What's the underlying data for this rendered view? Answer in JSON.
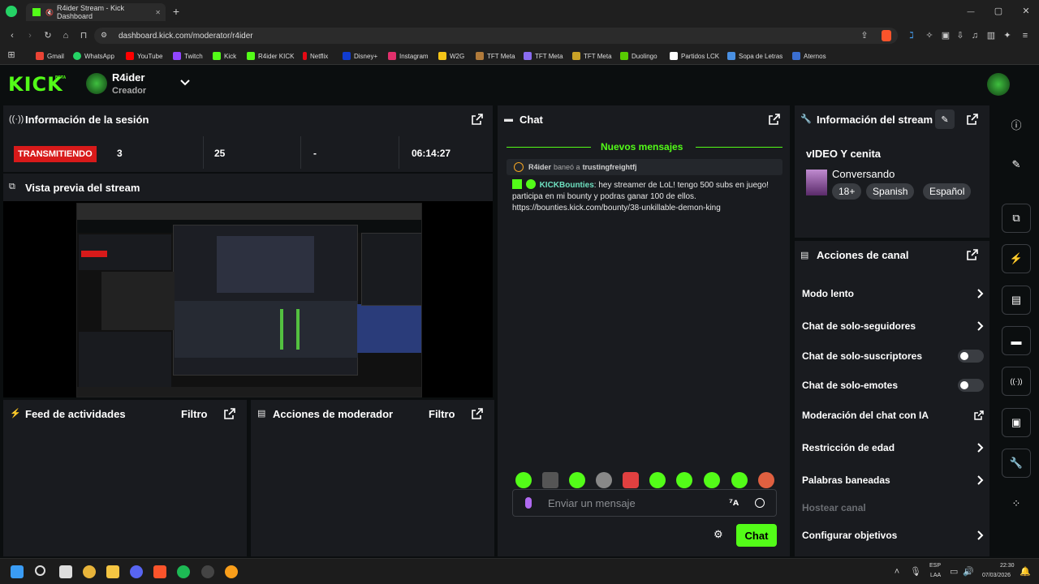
{
  "browser": {
    "tabs": [
      {
        "label": "R4ider Stream - Kick Dashboard",
        "close": "✕"
      }
    ],
    "new_tab": "+",
    "url": "dashboard.kick.com/moderator/r4ider",
    "window_controls": {
      "minimize": "—",
      "maximize": "▢",
      "close": "✕"
    },
    "bookmarks": [
      {
        "label": "Gmail",
        "color": "#ea4335"
      },
      {
        "label": "WhatsApp",
        "color": "#25d366"
      },
      {
        "label": "YouTube",
        "color": "#ff0000"
      },
      {
        "label": "Twitch",
        "color": "#9146ff"
      },
      {
        "label": "Kick",
        "color": "#53fc18"
      },
      {
        "label": "R4ider KICK",
        "color": "#53fc18"
      },
      {
        "label": "Netflix",
        "color": "#e50914"
      },
      {
        "label": "Disney+",
        "color": "#113ccf"
      },
      {
        "label": "Instagram",
        "color": "#e1306c"
      },
      {
        "label": "W2G",
        "color": "#f5c518"
      },
      {
        "label": "TFT Meta",
        "color": "#b07a3a"
      },
      {
        "label": "TFT Meta",
        "color": "#8a6cf0"
      },
      {
        "label": "TFT Meta",
        "color": "#c9a227"
      },
      {
        "label": "Duolingo",
        "color": "#58cc02"
      },
      {
        "label": "Partidos LCK",
        "color": "#ffffff"
      },
      {
        "label": "Sopa de Letras",
        "color": "#4a90e2"
      },
      {
        "label": "Aternos",
        "color": "#3b6fd1"
      }
    ]
  },
  "header": {
    "logo": "KICK",
    "logo_badge": "BETA",
    "channel_name": "R4ider",
    "channel_role": "Creador"
  },
  "session": {
    "title": "Información de la sesión",
    "status": "TRANSMITIENDO",
    "stats": [
      "3",
      "25",
      "-",
      "06:14:27"
    ]
  },
  "preview": {
    "title": "Vista previa del stream"
  },
  "activity": {
    "title": "Feed de actividades",
    "filter": "Filtro"
  },
  "mod_actions": {
    "title": "Acciones de moderador",
    "filter": "Filtro"
  },
  "chat": {
    "title": "Chat",
    "new_messages": "Nuevos mensajes",
    "ban_notice": {
      "user": "R4ider",
      "action": "baneó a",
      "target": "trustingfreightfj"
    },
    "message": {
      "user": "KICKBounties",
      "text": ": hey streamer de LoL! tengo 500 subs en juego! participa en mi bounty y podras ganar 100 de ellos. https://bounties.kick.com/bounty/38-unkillable-demon-king"
    },
    "input_placeholder": "Enviar un mensaje",
    "send_button": "Chat",
    "emote_colors": [
      "#53fc18",
      "#555555",
      "#53fc18",
      "#888888",
      "#e04040",
      "#53fc18",
      "#53fc18",
      "#53fc18",
      "#53fc18",
      "#e06040"
    ]
  },
  "stream_info": {
    "title": "Información del stream",
    "stream_title": "vIDEO Y cenita",
    "category": "Conversando",
    "tags": [
      "18+",
      "Spanish",
      "Español"
    ]
  },
  "channel_actions": {
    "title": "Acciones de canal",
    "items": [
      {
        "label": "Modo lento",
        "control": "chevron"
      },
      {
        "label": "Chat de solo-seguidores",
        "control": "chevron"
      },
      {
        "label": "Chat de solo-suscriptores",
        "control": "toggle"
      },
      {
        "label": "Chat de solo-emotes",
        "control": "toggle"
      },
      {
        "label": "Moderación del chat con IA",
        "control": "external"
      },
      {
        "label": "Restricción de edad",
        "control": "chevron"
      },
      {
        "label": "Palabras baneadas",
        "control": "chevron"
      },
      {
        "label": "Hostear canal",
        "control": "disabled"
      },
      {
        "label": "Configurar objetivos",
        "control": "chevron"
      }
    ]
  },
  "sidebar": {
    "icons": [
      "info-icon",
      "edit-icon",
      "screen-capture-icon",
      "bolt-icon",
      "document-icon",
      "chat-bubble-icon",
      "broadcast-icon",
      "moderator-actions-icon",
      "wrench-icon",
      "more-icon"
    ]
  },
  "taskbar": {
    "lang": "ESP",
    "layout": "LAA",
    "time": "22:30",
    "date": "07/03/2026"
  }
}
